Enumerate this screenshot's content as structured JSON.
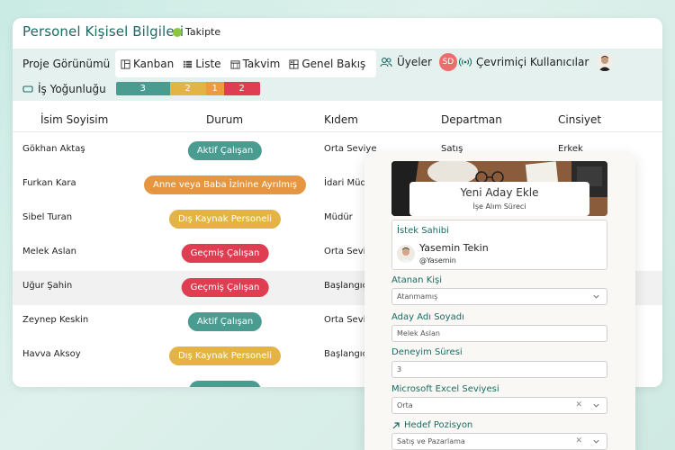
{
  "header": {
    "title": "Personel Kişisel Bilgileri",
    "status": "Takipte",
    "status_color": "#8cc63f"
  },
  "toolbar": {
    "view_label": "Proje Görünümü",
    "views": [
      {
        "label": "Kanban",
        "icon": "kanban-icon"
      },
      {
        "label": "Liste",
        "icon": "list-icon"
      },
      {
        "label": "Takvim",
        "icon": "calendar-icon"
      },
      {
        "label": "Genel Bakış",
        "icon": "overview-icon"
      }
    ],
    "users_label": "Üyeler",
    "user_initials": "SD",
    "online_label": "Çevrimiçi Kullanıcılar",
    "workload_label": "İş Yoğunluğu",
    "workload": [
      {
        "value": "3",
        "color": "#4a9b90"
      },
      {
        "value": "2",
        "color": "#e3b343"
      },
      {
        "value": "1",
        "color": "#ee9b3c"
      },
      {
        "value": "2",
        "color": "#de3d52"
      }
    ]
  },
  "table": {
    "columns": [
      "İsim Soyisim",
      "Durum",
      "Kıdem",
      "Departman",
      "Cinsiyet"
    ],
    "rows": [
      {
        "name": "Gökhan Aktaş",
        "status": "Aktif Çalışan",
        "status_color": "#4a9b90",
        "seniority": "Orta Seviye",
        "department": "Satış",
        "gender": "Erkek"
      },
      {
        "name": "Furkan Kara",
        "status": "Anne veya Baba İzinine Ayrılmış",
        "status_color": "#e69640",
        "seniority": "İdari Müdür",
        "department": "",
        "gender": ""
      },
      {
        "name": "Sibel Turan",
        "status": "Dış Kaynak Personeli",
        "status_color": "#e3b343",
        "seniority": "Müdür",
        "department": "",
        "gender": ""
      },
      {
        "name": "Melek Aslan",
        "status": "Geçmiş Çalışan",
        "status_color": "#de3d52",
        "seniority": "Orta Seviye",
        "department": "",
        "gender": ""
      },
      {
        "name": "Uğur Şahin",
        "status": "Geçmiş Çalışan",
        "status_color": "#de3d52",
        "seniority": "Başlangıç",
        "department": "",
        "gender": ""
      },
      {
        "name": "Zeynep Keskin",
        "status": "Aktif Çalışan",
        "status_color": "#4a9b90",
        "seniority": "Orta Seviye",
        "department": "",
        "gender": ""
      },
      {
        "name": "Havva Aksoy",
        "status": "Dış Kaynak Personeli",
        "status_color": "#e3b343",
        "seniority": "Başlangıç",
        "department": "",
        "gender": ""
      }
    ]
  },
  "form": {
    "title": "Yeni Aday Ekle",
    "subtitle": "İşe Alım Süreci",
    "requester_label": "İstek Sahibi",
    "requester_name": "Yasemin Tekin",
    "requester_handle": "@Yasemin",
    "assignee_label": "Atanan Kişi",
    "assignee_value": "Atanmamış",
    "candidate_label": "Aday Adı Soyadı",
    "candidate_value": "Melek Aslan",
    "experience_label": "Deneyim Süresi",
    "experience_value": "3",
    "excel_label": "Microsoft Excel Seviyesi",
    "excel_value": "Orta",
    "position_label": "Hedef Pozisyon",
    "position_value": "Satış ve Pazarlama"
  },
  "colors": {
    "accent": "#1b6a64",
    "toolbar_bg": "#e4f1ef",
    "avatar_sd": "#ec6d6d"
  }
}
